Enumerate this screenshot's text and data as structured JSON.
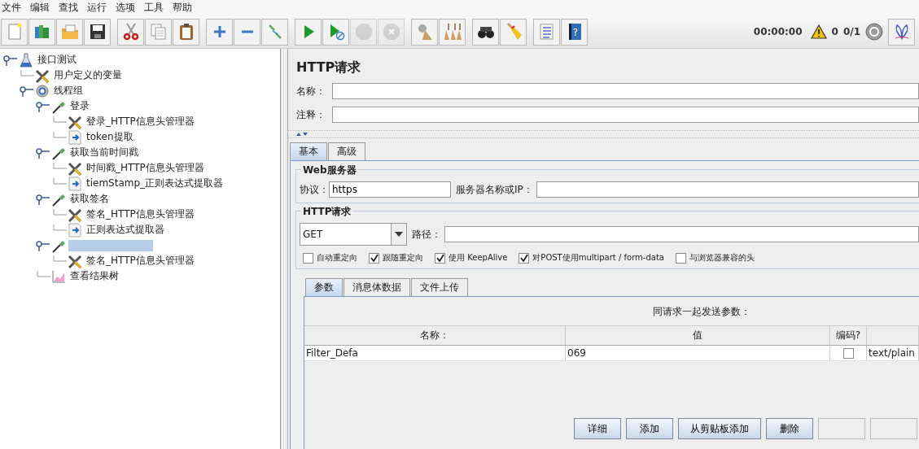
{
  "menu": [
    "文件",
    "编辑",
    "查找",
    "运行",
    "选项",
    "工具",
    "帮助"
  ],
  "toolbar": [
    [
      {
        "kind": "new",
        "disabled": false
      },
      {
        "kind": "templates",
        "disabled": false
      },
      {
        "kind": "open",
        "disabled": false
      },
      {
        "kind": "save",
        "disabled": false
      }
    ],
    [
      {
        "kind": "cut",
        "disabled": false
      },
      {
        "kind": "copy",
        "disabled": false
      },
      {
        "kind": "paste",
        "disabled": false
      }
    ],
    [
      {
        "kind": "expand",
        "disabled": false
      },
      {
        "kind": "collapse",
        "disabled": false
      },
      {
        "kind": "toggle",
        "disabled": false
      }
    ],
    [
      {
        "kind": "start",
        "disabled": false
      },
      {
        "kind": "start-no-pause",
        "disabled": false
      },
      {
        "kind": "stop",
        "disabled": true
      },
      {
        "kind": "shutdown",
        "disabled": true
      }
    ],
    [
      {
        "kind": "clear",
        "disabled": false
      },
      {
        "kind": "clear-all",
        "disabled": false
      }
    ],
    [
      {
        "kind": "search",
        "disabled": false
      },
      {
        "kind": "reset-search",
        "disabled": false
      }
    ],
    [
      {
        "kind": "function-helper",
        "disabled": false
      },
      {
        "kind": "help",
        "disabled": false,
        "glyph": "?"
      }
    ]
  ],
  "status": {
    "timer": "00:00:00",
    "warnings": "0",
    "threads": "0/1"
  },
  "tree": {
    "label": "接口测试",
    "kind": "testplan",
    "expanded": true,
    "selected": false,
    "children": [
      {
        "label": "用户定义的变量",
        "kind": "config",
        "selected": false
      },
      {
        "label": "线程组",
        "kind": "threadgroup",
        "expanded": true,
        "selected": false,
        "children": [
          {
            "label": "登录",
            "kind": "sampler",
            "expanded": true,
            "selected": false,
            "children": [
              {
                "label": "登录_HTTP信息头管理器",
                "kind": "config",
                "selected": false
              },
              {
                "label": "token提取",
                "kind": "extractor",
                "selected": false
              }
            ]
          },
          {
            "label": "获取当前时间戳",
            "kind": "sampler",
            "expanded": true,
            "selected": false,
            "children": [
              {
                "label": "时间戳_HTTP信息头管理器",
                "kind": "config",
                "selected": false
              },
              {
                "label": "tiemStamp_正则表达式提取器",
                "kind": "extractor",
                "selected": false
              }
            ]
          },
          {
            "label": "获取签名",
            "kind": "sampler",
            "expanded": true,
            "selected": false,
            "children": [
              {
                "label": "签名_HTTP信息头管理器",
                "kind": "config",
                "selected": false
              },
              {
                "label": "正则表达式提取器",
                "kind": "extractor",
                "selected": false
              }
            ]
          },
          {
            "kind": "sampler",
            "expanded": true,
            "selected": true,
            "children": [
              {
                "label": "签名_HTTP信息头管理器",
                "kind": "config",
                "selected": false
              }
            ]
          },
          {
            "label": "查看结果树",
            "kind": "listener",
            "selected": false
          }
        ]
      }
    ]
  },
  "panel": {
    "title": "HTTP请求",
    "name_label": "名称：",
    "comment_label": "注释：",
    "tabs": [
      {
        "label": "基本",
        "selected": true
      },
      {
        "label": "高级",
        "selected": false
      }
    ],
    "web_server": {
      "title": "Web服务器",
      "protocol_label": "协议：",
      "protocol": "https",
      "server_label": "服务器名称或IP："
    },
    "http_request": {
      "title": "HTTP请求",
      "method": "GET",
      "path_label": "路径：",
      "options": [
        {
          "label": "自动重定向",
          "checked": false
        },
        {
          "label": "跟随重定向",
          "checked": true
        },
        {
          "label": "使用 KeepAlive",
          "checked": true
        },
        {
          "label": "对POST使用multipart / form-data",
          "checked": true
        },
        {
          "label": "与浏览器兼容的头",
          "checked": false
        }
      ]
    },
    "sub_tabs": [
      {
        "label": "参数",
        "selected": true
      },
      {
        "label": "消息体数据",
        "selected": false
      },
      {
        "label": "文件上传",
        "selected": false
      }
    ],
    "table": {
      "caption": "同请求一起发送参数：",
      "columns": [
        "名称：",
        "值",
        "编码?"
      ],
      "rows": [
        {
          "name": "Filter_Defa",
          "value": "069",
          "encode": false,
          "content_type": "text/plain"
        }
      ]
    },
    "buttons": [
      {
        "label": "详细",
        "disabled": false
      },
      {
        "label": "添加",
        "disabled": false
      },
      {
        "label": "从剪贴板添加",
        "disabled": false
      },
      {
        "label": "删除",
        "disabled": false
      },
      {
        "disabled": true
      },
      {
        "disabled": true
      }
    ]
  }
}
